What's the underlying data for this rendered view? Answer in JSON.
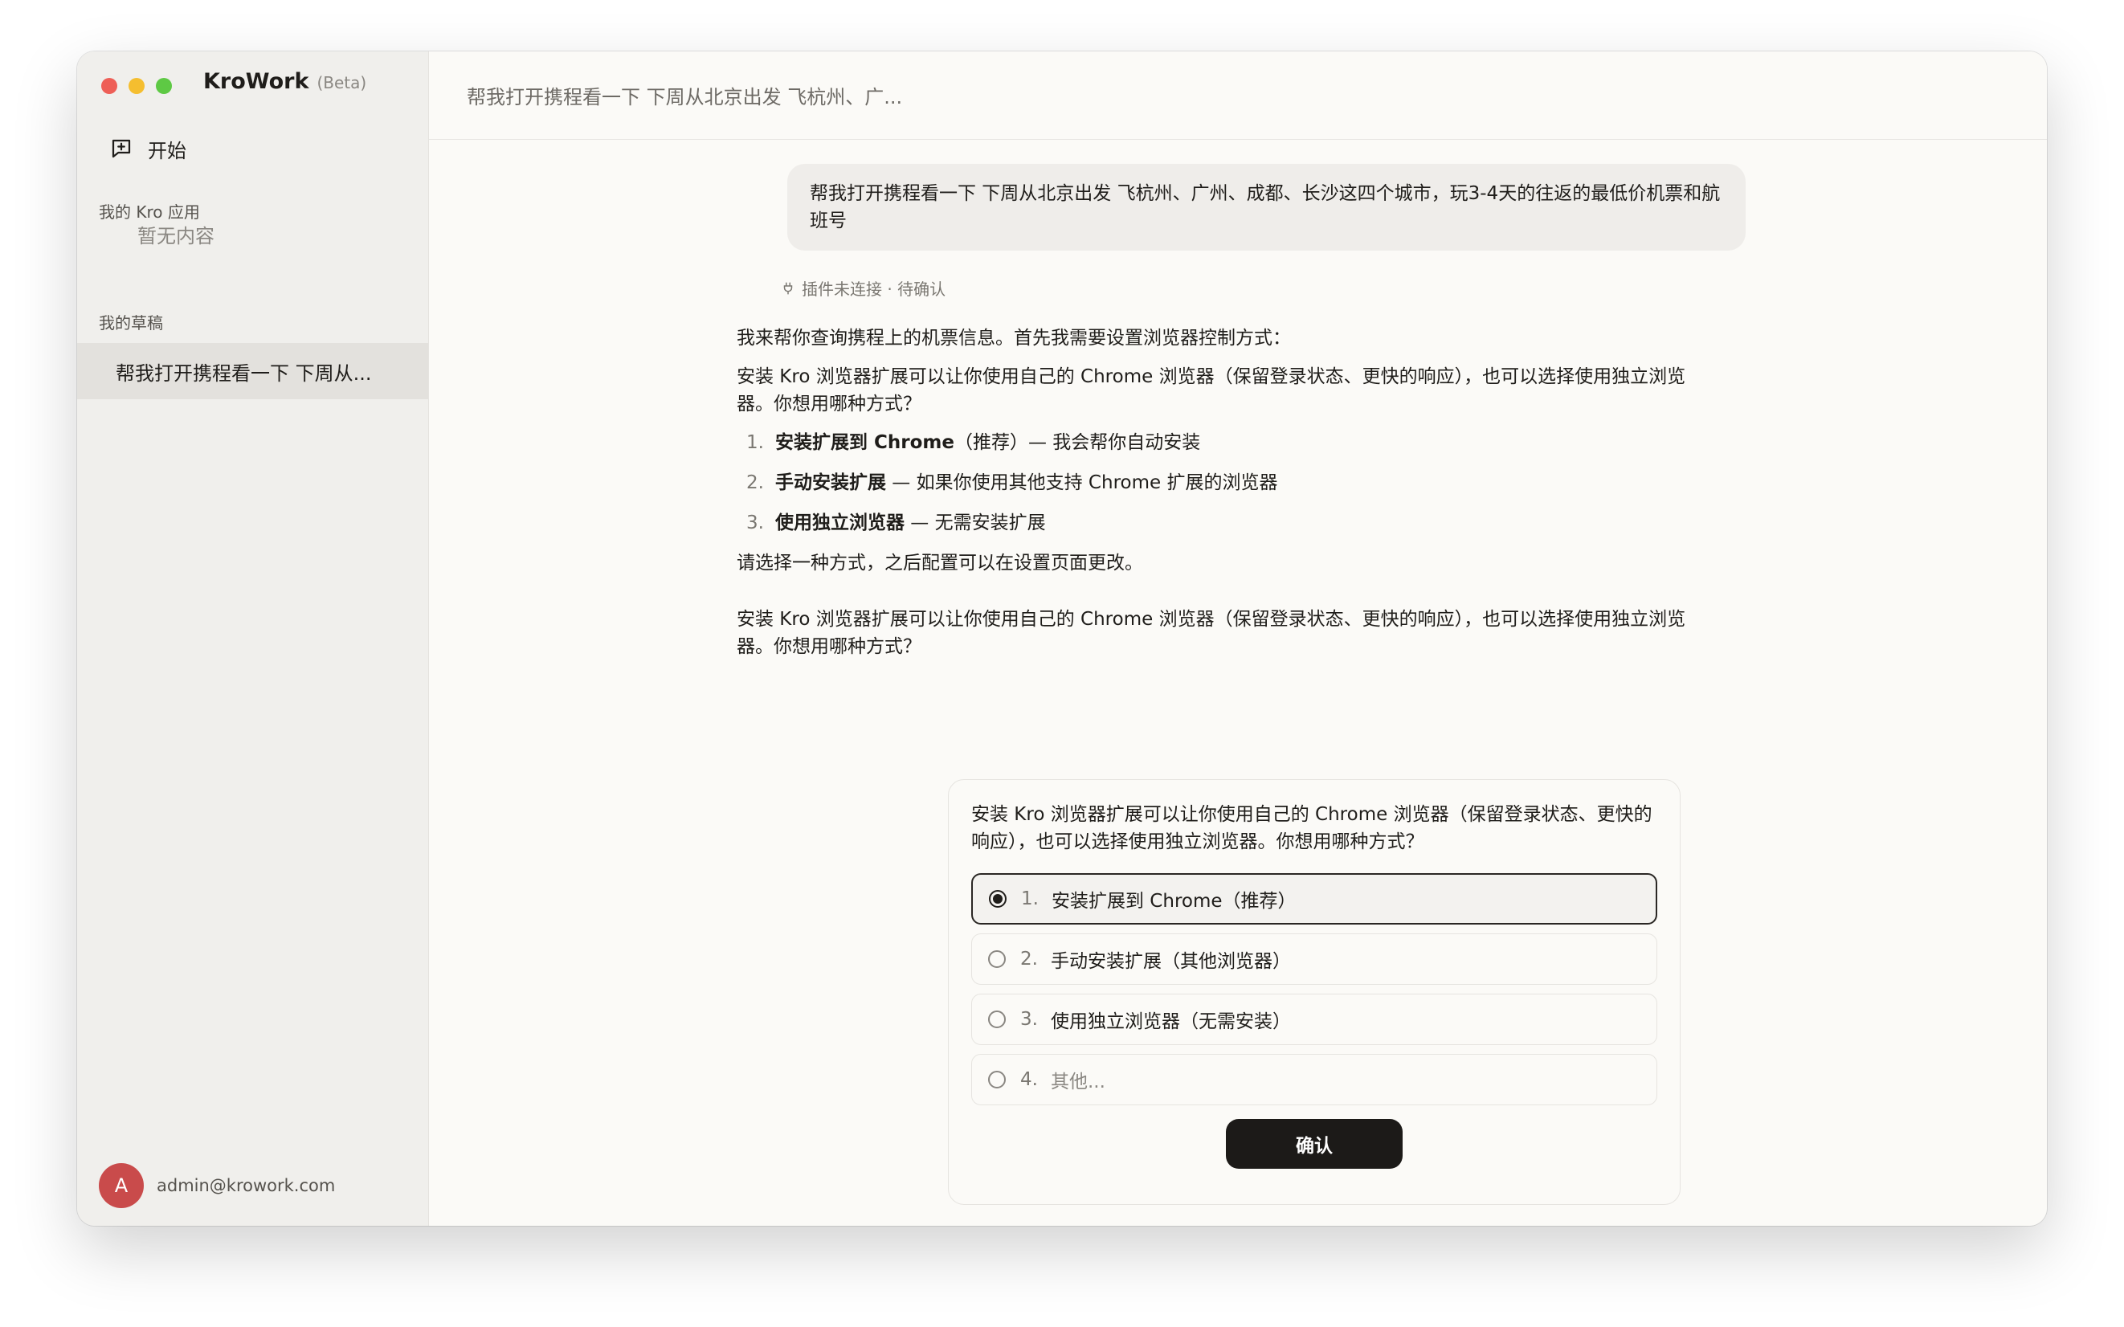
{
  "app": {
    "name": "KroWork",
    "tag": "(Beta)"
  },
  "sidebar": {
    "new_label": "开始",
    "apps_section": "我的 Kro 应用",
    "apps_empty": "暂无内容",
    "drafts_section": "我的草稿",
    "drafts": [
      {
        "label": "帮我打开携程看一下 下周从..."
      }
    ],
    "user_initial": "A",
    "user_email": "admin@krowork.com"
  },
  "main": {
    "header_title": "帮我打开携程看一下 下周从北京出发 飞杭州、广...",
    "user_message": "帮我打开携程看一下 下周从北京出发 飞杭州、广州、成都、长沙这四个城市，玩3-4天的往返的最低价机票和航班号",
    "plugin_status": "插件未连接 · 待确认",
    "reply": {
      "intro": "我来帮你查询携程上的机票信息。首先我需要设置浏览器控制方式：",
      "desc": "安装 Kro 浏览器扩展可以让你使用自己的 Chrome 浏览器（保留登录状态、更快的响应），也可以选择使用独立浏览器。你想用哪种方式？",
      "options": [
        {
          "num": "1.",
          "bold": "安装扩展到 Chrome",
          "rest": "（推荐）— 我会帮你自动安装"
        },
        {
          "num": "2.",
          "bold": "手动安装扩展",
          "rest": " — 如果你使用其他支持 Chrome 扩展的浏览器"
        },
        {
          "num": "3.",
          "bold": "使用独立浏览器",
          "rest": " — 无需安装扩展"
        }
      ],
      "note": "请选择一种方式，之后配置可以在设置页面更改。",
      "desc2": "安装 Kro 浏览器扩展可以让你使用自己的 Chrome 浏览器（保留登录状态、更快的响应），也可以选择使用独立浏览器。你想用哪种方式？"
    }
  },
  "question_card": {
    "question": "安装 Kro 浏览器扩展可以让你使用自己的 Chrome 浏览器（保留登录状态、更快的响应），也可以选择使用独立浏览器。你想用哪种方式？",
    "options": [
      {
        "num": "1.",
        "label": "安装扩展到 Chrome（推荐）",
        "selected": true
      },
      {
        "num": "2.",
        "label": "手动安装扩展（其他浏览器）",
        "selected": false
      },
      {
        "num": "3.",
        "label": "使用独立浏览器（无需安装）",
        "selected": false
      },
      {
        "num": "4.",
        "label": "其他...",
        "selected": false
      }
    ],
    "confirm_label": "确认"
  }
}
